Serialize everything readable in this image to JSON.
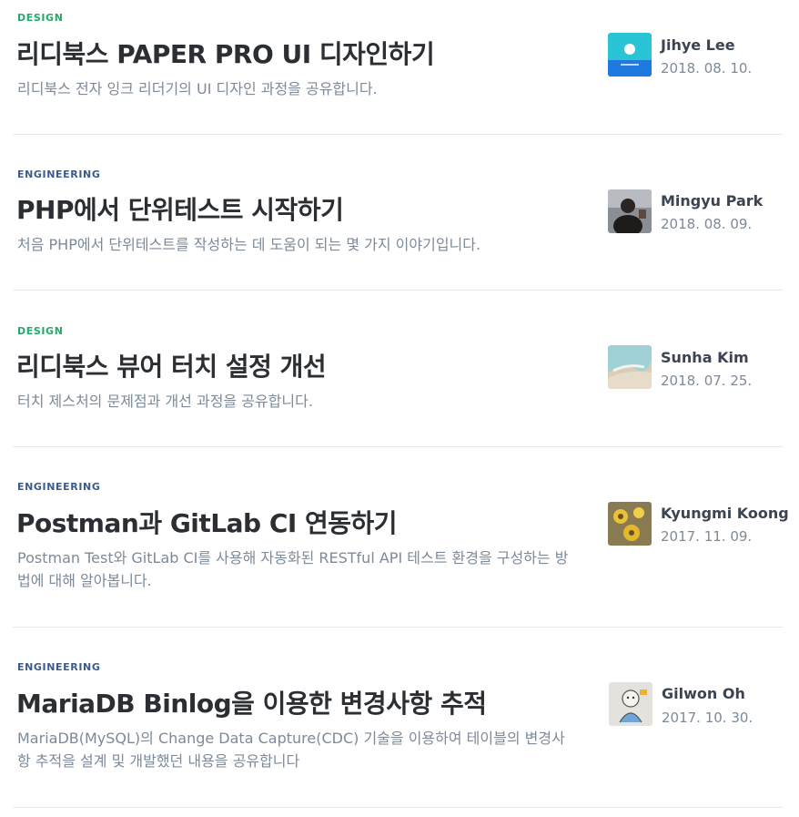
{
  "colors": {
    "design": "#27a86a",
    "engineering": "#3b5b8c"
  },
  "posts": [
    {
      "category": "DESIGN",
      "title": "리디북스 PAPER PRO UI 디자인하기",
      "description": "리디북스 전자 잉크 리더기의 UI 디자인 과정을 공유합니다.",
      "author": "Jihye Lee",
      "date": "2018. 08. 10."
    },
    {
      "category": "ENGINEERING",
      "title": "PHP에서 단위테스트 시작하기",
      "description": "처음 PHP에서 단위테스트를 작성하는 데 도움이 되는 몇 가지 이야기입니다.",
      "author": "Mingyu Park",
      "date": "2018. 08. 09."
    },
    {
      "category": "DESIGN",
      "title": "리디북스 뷰어 터치 설정 개선",
      "description": "터치 제스처의 문제점과 개선 과정을 공유합니다.",
      "author": "Sunha Kim",
      "date": "2018. 07. 25."
    },
    {
      "category": "ENGINEERING",
      "title": "Postman과 GitLab CI 연동하기",
      "description": "Postman Test와 GitLab CI를 사용해 자동화된 RESTful API 테스트 환경을 구성하는 방법에 대해 알아봅니다.",
      "author": "Kyungmi Koong",
      "date": "2017. 11. 09."
    },
    {
      "category": "ENGINEERING",
      "title": "MariaDB Binlog을 이용한 변경사항 추적",
      "description": "MariaDB(MySQL)의 Change Data Capture(CDC) 기술을 이용하여 테이블의 변경사항 추적을 설계 및 개발했던 내용을 공유합니다",
      "author": "Gilwon Oh",
      "date": "2017. 10. 30."
    }
  ]
}
